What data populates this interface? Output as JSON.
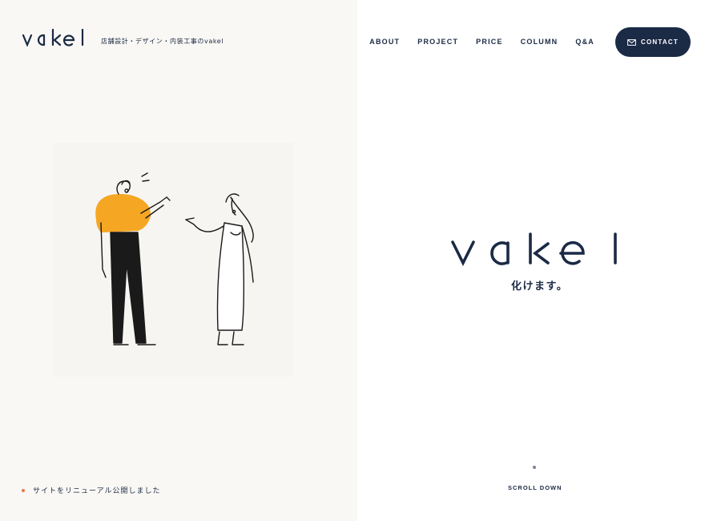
{
  "brand": {
    "logo_text": "vakel",
    "tagline": "店舗設計・デザイン・内装工事のvakel",
    "navy": "#1b2a45",
    "accent_orange": "#f5a623",
    "news_dot_color": "#e8764d"
  },
  "nav": {
    "items": [
      {
        "label": "ABOUT"
      },
      {
        "label": "PROJECT"
      },
      {
        "label": "PRICE"
      },
      {
        "label": "COLUMN"
      },
      {
        "label": "Q&A"
      }
    ],
    "contact_label": "CONTACT",
    "contact_icon": "envelope-icon"
  },
  "hero": {
    "logo_text": "vakel",
    "subtitle": "化けます。"
  },
  "news": {
    "text": "サイトをリニューアル公開しました"
  },
  "scroll": {
    "label": "SCROLL DOWN"
  }
}
